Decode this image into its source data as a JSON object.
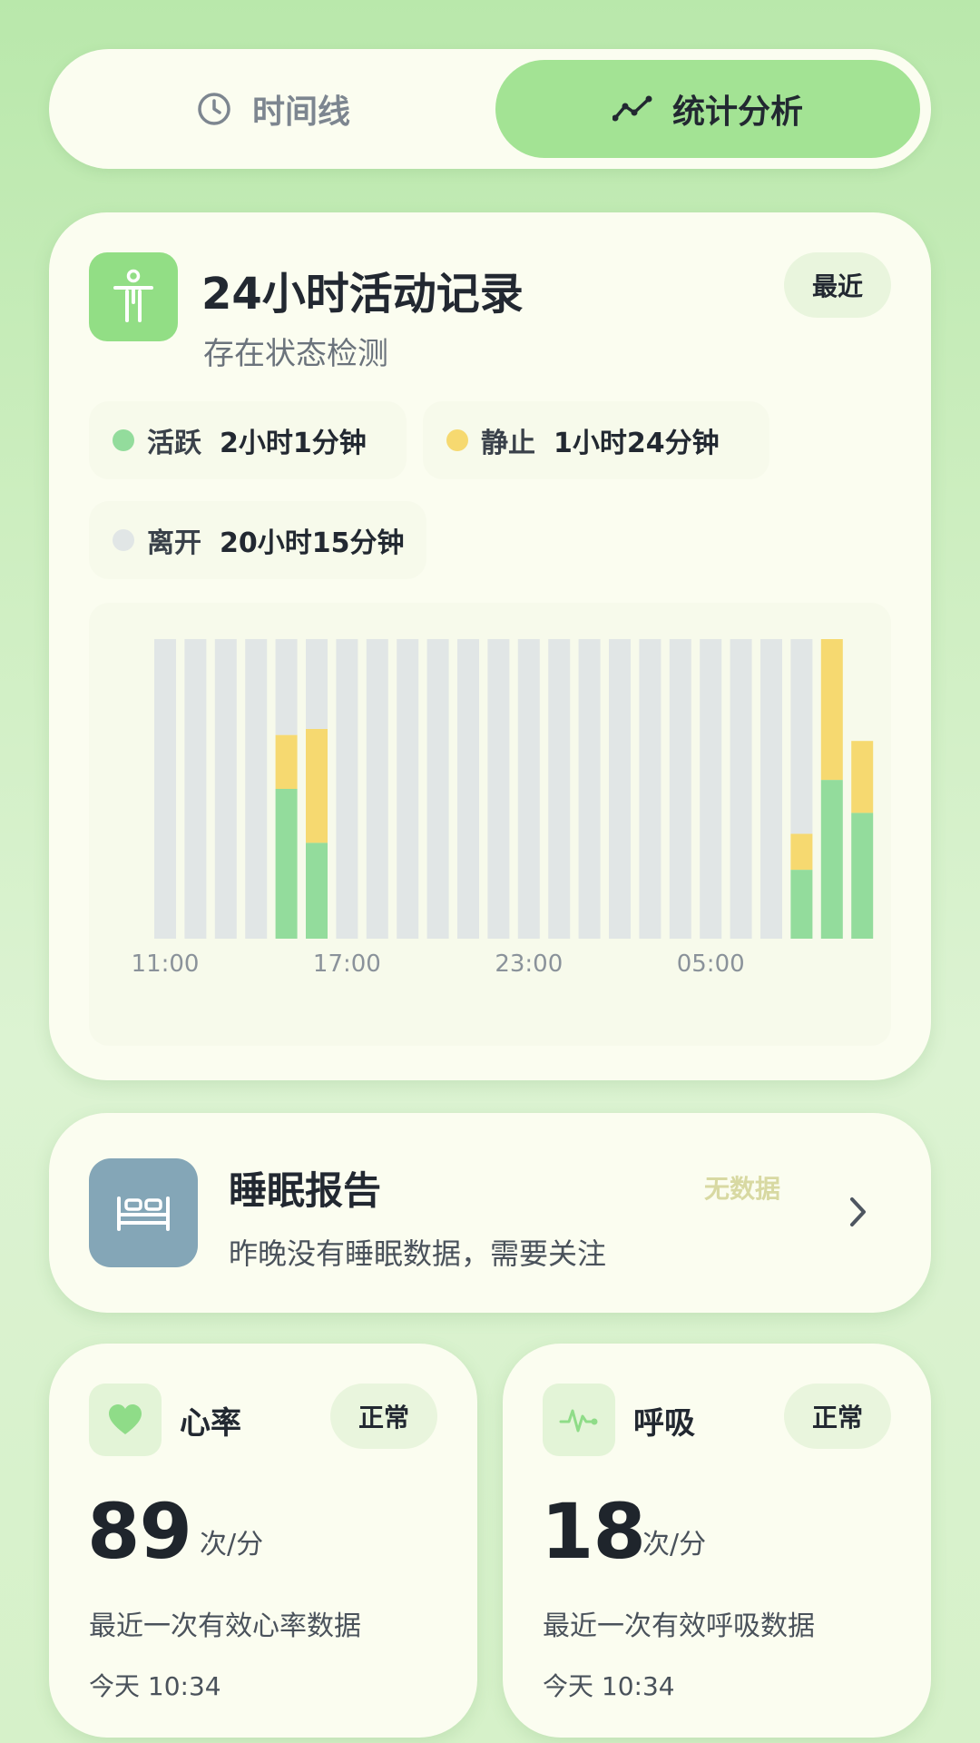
{
  "tabs": [
    {
      "label": "时间线",
      "icon": "clock-icon",
      "active": false
    },
    {
      "label": "统计分析",
      "icon": "trend-line-icon",
      "active": true
    }
  ],
  "activity": {
    "icon": "person-standing-icon",
    "title": "24小时活动记录",
    "subtitle": "存在状态检测",
    "badge": "最近",
    "legend": [
      {
        "label": "活跃",
        "value": "2小时1分钟",
        "color": "#93dc9c"
      },
      {
        "label": "静止",
        "value": "1小时24分钟",
        "color": "#f6d970"
      },
      {
        "label": "离开",
        "value": "20小时15分钟",
        "color": "#e1e6e6"
      }
    ]
  },
  "chart_data": {
    "type": "bar",
    "stacked": true,
    "ylim": [
      0,
      1
    ],
    "x_tick_labels": [
      "11:00",
      "17:00",
      "23:00",
      "05:00"
    ],
    "x_tick_positions": [
      0,
      6,
      12,
      18
    ],
    "series": [
      {
        "key": "active",
        "color": "#93dc9c",
        "values": [
          0,
          0,
          0,
          0,
          0.5,
          0.32,
          0,
          0,
          0,
          0,
          0,
          0,
          0,
          0,
          0,
          0,
          0,
          0,
          0,
          0,
          0,
          0.23,
          0.53,
          0.42
        ]
      },
      {
        "key": "still",
        "color": "#f6d970",
        "values": [
          0,
          0,
          0,
          0,
          0.18,
          0.38,
          0,
          0,
          0,
          0,
          0,
          0,
          0,
          0,
          0,
          0,
          0,
          0,
          0,
          0,
          0,
          0.12,
          0.47,
          0.24
        ]
      },
      {
        "key": "away",
        "color": "#e1e6e6",
        "values": [
          1,
          1,
          1,
          1,
          0.32,
          0.3,
          1,
          1,
          1,
          1,
          1,
          1,
          1,
          1,
          1,
          1,
          1,
          1,
          1,
          1,
          1,
          0.65,
          0,
          0
        ]
      }
    ]
  },
  "sleep": {
    "icon": "bed-icon",
    "title": "睡眠报告",
    "description": "昨晚没有睡眠数据，需要关注",
    "status": "无数据"
  },
  "vitals": {
    "heart": {
      "icon": "heart-icon",
      "title": "心率",
      "badge": "正常",
      "value": "89",
      "unit": "次/分",
      "description": "最近一次有效心率数据",
      "time": "今天 10:34"
    },
    "breath": {
      "icon": "pulse-wave-icon",
      "title": "呼吸",
      "badge": "正常",
      "value": "18",
      "unit": "次/分",
      "description": "最近一次有效呼吸数据",
      "time": "今天 10:34"
    }
  }
}
